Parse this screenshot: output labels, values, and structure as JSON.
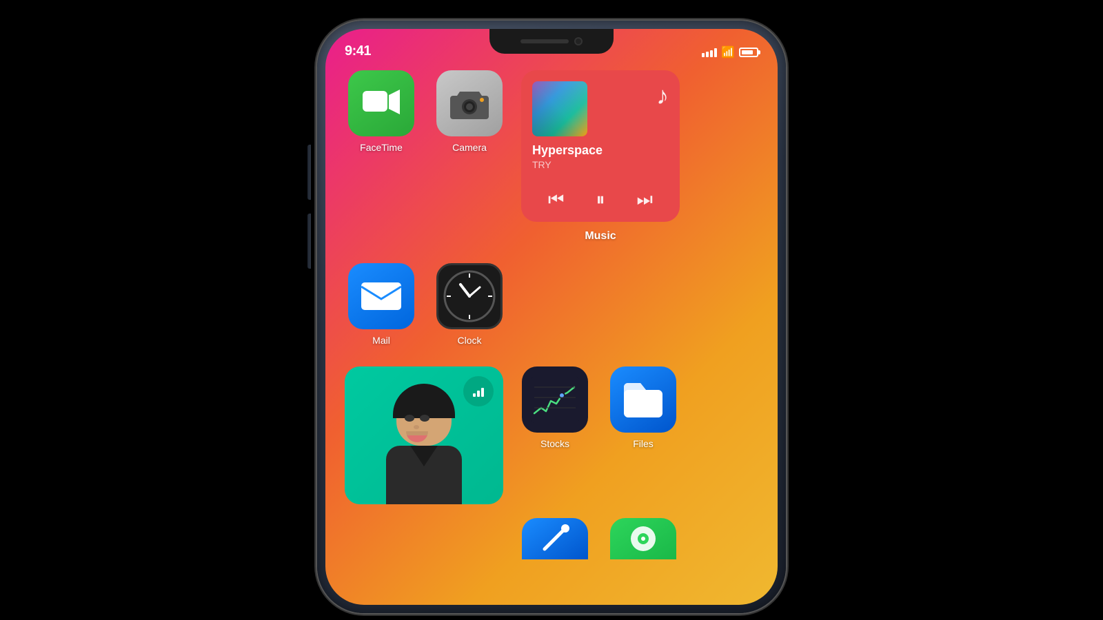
{
  "phone": {
    "status": {
      "time": "9:41",
      "battery_label": "Battery"
    },
    "apps": {
      "facetime": {
        "label": "FaceTime"
      },
      "camera": {
        "label": "Camera"
      },
      "mail": {
        "label": "Mail"
      },
      "clock": {
        "label": "Clock"
      },
      "music": {
        "label": "Music",
        "song_title": "Hyperspace",
        "song_artist": "TRY"
      },
      "stocks": {
        "label": "Stocks"
      },
      "files": {
        "label": "Files"
      }
    }
  }
}
